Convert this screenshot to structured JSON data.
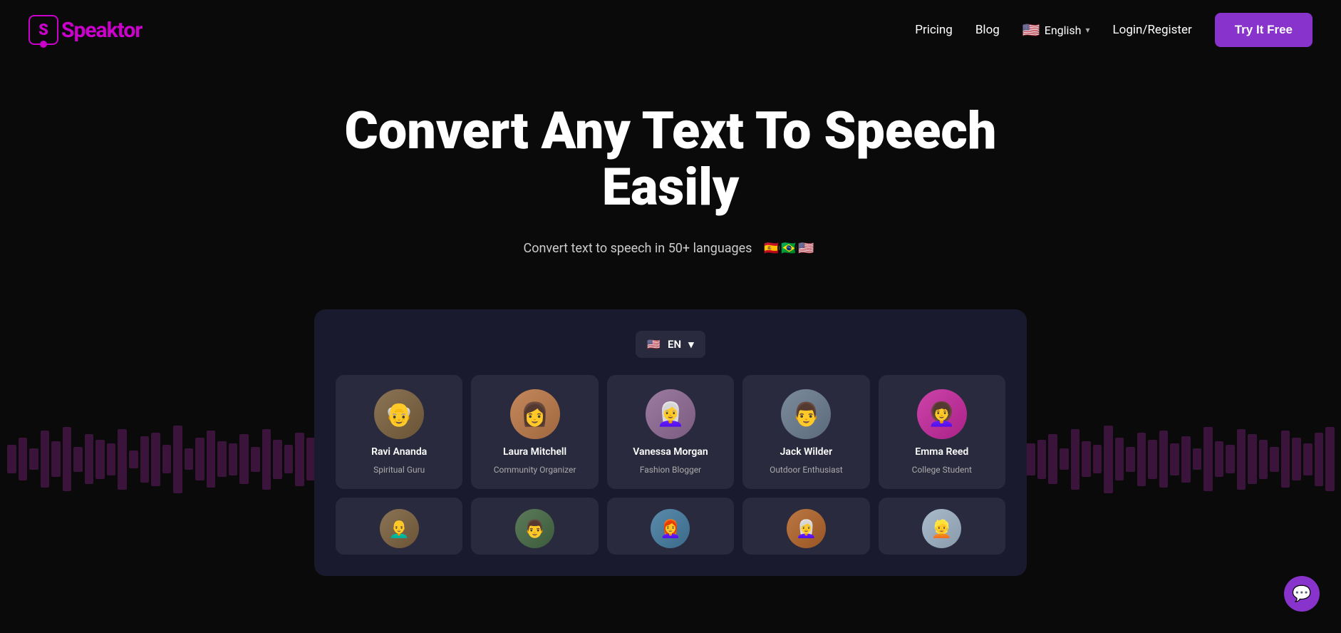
{
  "brand": {
    "logo_letter": "S",
    "logo_name": "Speaktor"
  },
  "navbar": {
    "pricing_label": "Pricing",
    "blog_label": "Blog",
    "lang_label": "English",
    "lang_flag": "🇺🇸",
    "login_label": "Login/Register",
    "try_free_label": "Try It Free"
  },
  "hero": {
    "title": "Convert Any Text To Speech Easily",
    "subtitle": "Convert text to speech in 50+ languages",
    "flags": [
      "🇪🇸",
      "🇧🇷",
      "🇺🇸"
    ]
  },
  "app": {
    "lang_selector": {
      "flag": "🇺🇸",
      "code": "EN"
    },
    "voices_row1": [
      {
        "name": "Ravi Ananda",
        "role": "Spiritual Guru",
        "avatar_class": "av-ravi",
        "emoji": "👴"
      },
      {
        "name": "Laura Mitchell",
        "role": "Community Organizer",
        "avatar_class": "av-laura",
        "emoji": "👩"
      },
      {
        "name": "Vanessa Morgan",
        "role": "Fashion Blogger",
        "avatar_class": "av-vanessa",
        "emoji": "👩‍🦳"
      },
      {
        "name": "Jack Wilder",
        "role": "Outdoor Enthusiast",
        "avatar_class": "av-jack",
        "emoji": "👨"
      },
      {
        "name": "Emma Reed",
        "role": "College Student",
        "avatar_class": "av-emma",
        "emoji": "👩‍🦱"
      }
    ],
    "voices_row2": [
      {
        "avatar_class": "av-r2",
        "emoji": "👨‍🦲"
      },
      {
        "avatar_class": "av-l2",
        "emoji": "👨"
      },
      {
        "avatar_class": "av-v2",
        "emoji": "👩‍🦰"
      },
      {
        "avatar_class": "av-j2",
        "emoji": "👩‍🦳"
      },
      {
        "avatar_class": "av-e2",
        "emoji": "👱"
      }
    ]
  },
  "chat_icon": "💬"
}
